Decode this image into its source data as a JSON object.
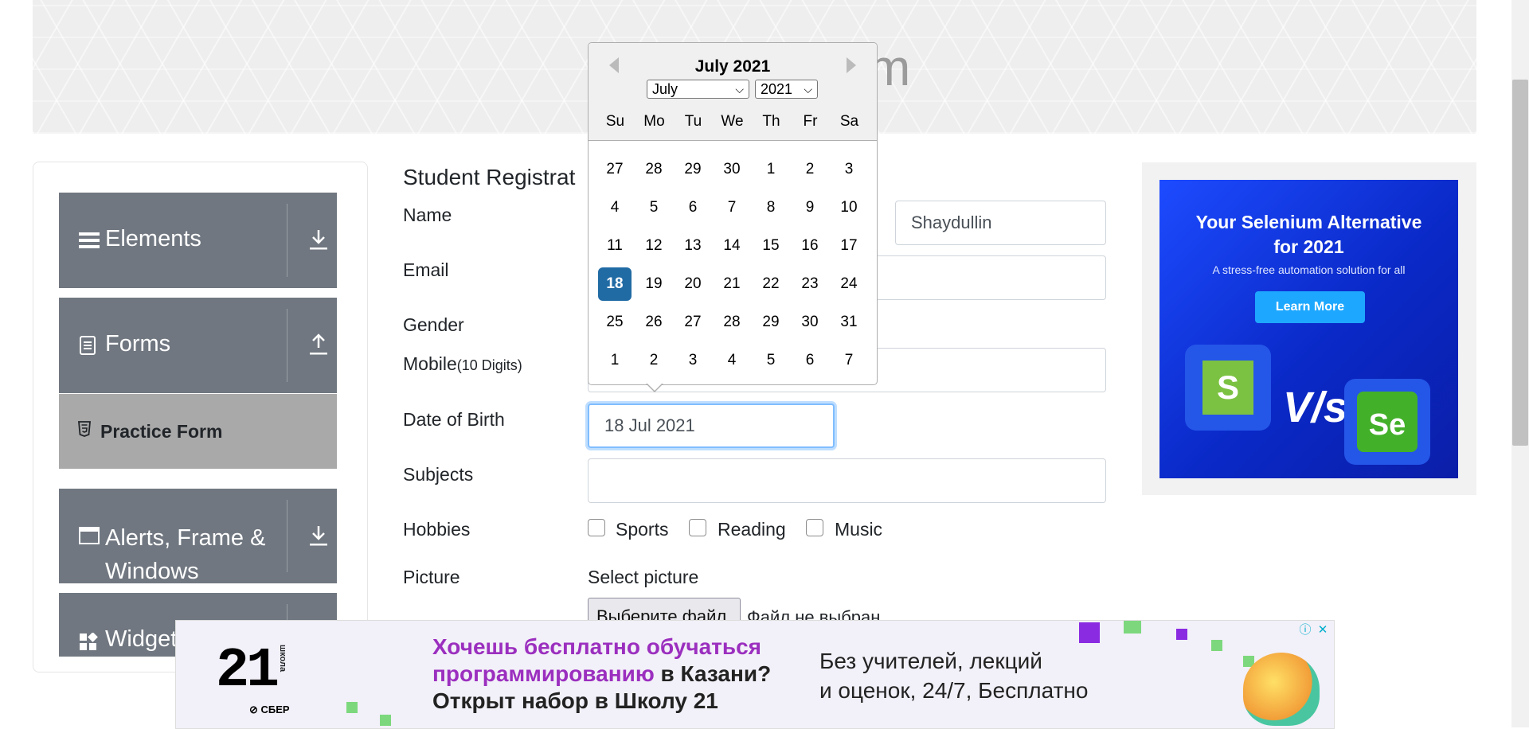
{
  "header": {
    "title": "m"
  },
  "sidebar": {
    "groups": [
      {
        "label": "Elements",
        "icon": "hamburger-icon",
        "arrow": "download-icon"
      },
      {
        "label": "Forms",
        "icon": "document-icon",
        "arrow": "upload-icon"
      },
      {
        "label_line1": "Alerts, Frame &",
        "label_line2": "Windows",
        "icon": "window-icon",
        "arrow": "download-icon"
      },
      {
        "label": "Widget",
        "icon": "widgets-icon"
      }
    ],
    "active_item": {
      "label": "Practice Form",
      "icon": "html5-icon"
    }
  },
  "form": {
    "title": "Student Registrat",
    "labels": {
      "name": "Name",
      "email": "Email",
      "gender": "Gender",
      "mobile": "Mobile",
      "mobile_hint": "(10 Digits)",
      "dob": "Date of Birth",
      "subjects": "Subjects",
      "hobbies": "Hobbies",
      "picture": "Picture"
    },
    "last_name_value": "Shaydullin",
    "dob_value": "18 Jul 2021",
    "hobbies": [
      "Sports",
      "Reading",
      "Music"
    ],
    "select_picture": "Select picture",
    "file_button": "Выберите файл",
    "file_status": "Файл не выбран"
  },
  "datepicker": {
    "month_title": "July 2021",
    "month_select": "July",
    "year_select": "2021",
    "weekdays": [
      "Su",
      "Mo",
      "Tu",
      "We",
      "Th",
      "Fr",
      "Sa"
    ],
    "weeks": [
      [
        "27",
        "28",
        "29",
        "30",
        "1",
        "2",
        "3"
      ],
      [
        "4",
        "5",
        "6",
        "7",
        "8",
        "9",
        "10"
      ],
      [
        "11",
        "12",
        "13",
        "14",
        "15",
        "16",
        "17"
      ],
      [
        "18",
        "19",
        "20",
        "21",
        "22",
        "23",
        "24"
      ],
      [
        "25",
        "26",
        "27",
        "28",
        "29",
        "30",
        "31"
      ],
      [
        "1",
        "2",
        "3",
        "4",
        "5",
        "6",
        "7"
      ]
    ],
    "selected_day": "18"
  },
  "ad_right": {
    "headline_line1": "Your Selenium Alternative",
    "headline_line2": "for 2021",
    "subline": "A stress-free automation solution for all",
    "button": "Learn More",
    "vs": "V/s",
    "logo_left": "S",
    "logo_right": "Se"
  },
  "bottom_ad": {
    "logo": "21",
    "logo_vertical": "школа",
    "sber": "⊘ СБЕР",
    "line1_purple": "Хочешь бесплатно обучаться",
    "line2_purple": "программированию",
    "line2_black": " в Казани?",
    "line3": "Открыт набор в Школу 21",
    "right_line1": "Без учителей, лекций",
    "right_line2": "и оценок, 24/7, Бесплатно",
    "info": "ⓘ",
    "close": "✕"
  }
}
